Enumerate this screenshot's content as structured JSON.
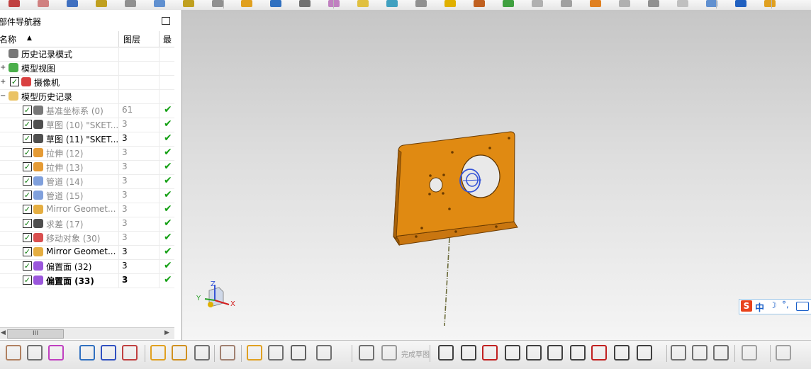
{
  "navigator": {
    "title": "部件导航器",
    "columns": {
      "name": "名称",
      "layer": "图层",
      "latest": "最"
    }
  },
  "tree": [
    {
      "name": "历史记录模式",
      "layer": "",
      "icon": "history-mode-icon",
      "indent": 0,
      "checked": false,
      "latest": false,
      "grayed": false
    },
    {
      "name": "模型视图",
      "layer": "",
      "icon": "model-views-icon",
      "indent": 0,
      "checked": false,
      "latest": false,
      "grayed": false,
      "expander": "+"
    },
    {
      "name": "摄像机",
      "layer": "",
      "icon": "cameras-icon",
      "indent": 0,
      "checked": true,
      "latest": false,
      "grayed": false,
      "expander": "+"
    },
    {
      "name": "模型历史记录",
      "layer": "",
      "icon": "folder-icon",
      "indent": 0,
      "checked": false,
      "latest": false,
      "grayed": false,
      "expander": "-"
    },
    {
      "name": "基准坐标系 (0)",
      "layer": "61",
      "icon": "datum-csys-icon",
      "indent": 1,
      "checked": true,
      "latest": true,
      "grayed": true
    },
    {
      "name": "草图 (10) \"SKET...",
      "layer": "3",
      "icon": "sketch-icon",
      "indent": 1,
      "checked": true,
      "latest": true,
      "grayed": true
    },
    {
      "name": "草图 (11) \"SKET...",
      "layer": "3",
      "icon": "sketch-icon",
      "indent": 1,
      "checked": true,
      "latest": true,
      "grayed": false
    },
    {
      "name": "拉伸 (12)",
      "layer": "3",
      "icon": "extrude-icon",
      "indent": 1,
      "checked": true,
      "latest": true,
      "grayed": true
    },
    {
      "name": "拉伸 (13)",
      "layer": "3",
      "icon": "extrude-icon",
      "indent": 1,
      "checked": true,
      "latest": true,
      "grayed": true
    },
    {
      "name": "管道 (14)",
      "layer": "3",
      "icon": "tube-icon",
      "indent": 1,
      "checked": true,
      "latest": true,
      "grayed": true
    },
    {
      "name": "管道 (15)",
      "layer": "3",
      "icon": "tube-icon",
      "indent": 1,
      "checked": true,
      "latest": true,
      "grayed": true
    },
    {
      "name": "Mirror Geomet...",
      "layer": "3",
      "icon": "mirror-geometry-icon",
      "indent": 1,
      "checked": true,
      "latest": true,
      "grayed": true
    },
    {
      "name": "求差 (17)",
      "layer": "3",
      "icon": "subtract-icon",
      "indent": 1,
      "checked": true,
      "latest": true,
      "grayed": true
    },
    {
      "name": "移动对象 (30)",
      "layer": "3",
      "icon": "move-object-icon",
      "indent": 1,
      "checked": true,
      "latest": true,
      "grayed": true
    },
    {
      "name": "Mirror Geomet...",
      "layer": "3",
      "icon": "mirror-geometry-icon",
      "indent": 1,
      "checked": true,
      "latest": true,
      "grayed": false
    },
    {
      "name": "偏置面 (32)",
      "layer": "3",
      "icon": "offset-face-icon",
      "indent": 1,
      "checked": true,
      "latest": true,
      "grayed": false
    },
    {
      "name": "偏置面 (33)",
      "layer": "3",
      "icon": "offset-face-icon",
      "indent": 1,
      "checked": true,
      "latest": true,
      "grayed": false,
      "bold": true
    }
  ],
  "scrollbar": {
    "thumb_grip": "III"
  },
  "viewport": {
    "triad": {
      "x_label": "X",
      "y_label": "Y",
      "z_label": "Z"
    }
  },
  "bottom_toolbar": {
    "finish_sketch": "完成草图"
  },
  "ime": {
    "logo": "S",
    "mode": "中"
  },
  "colors": {
    "part": "#e08a12",
    "check": "#14a014",
    "viewport_top": "#c6c6c6",
    "viewport_bottom": "#f5f5f5"
  }
}
